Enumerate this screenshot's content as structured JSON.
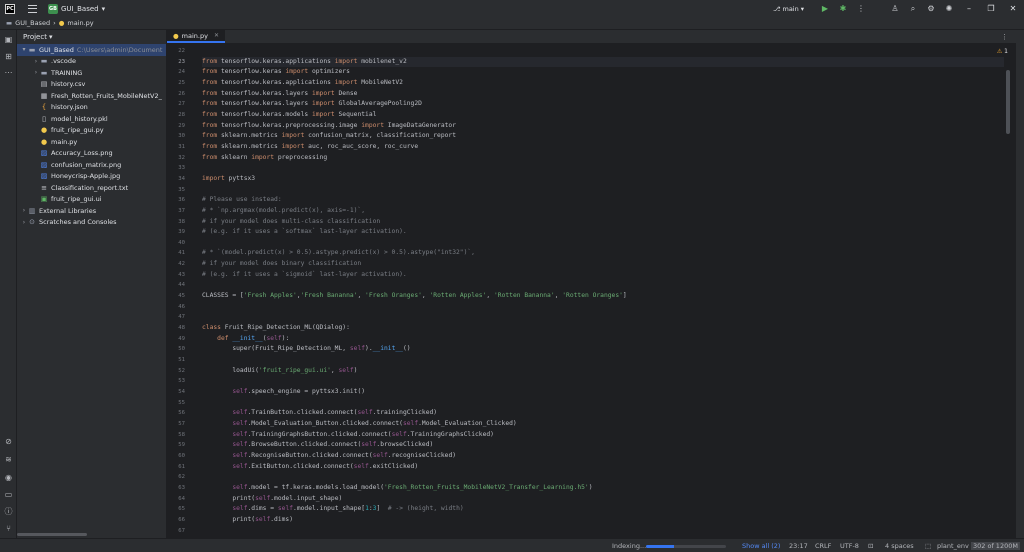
{
  "titlebar": {
    "logo": "PC",
    "project_badge": "GB",
    "project_name": "GUI_Based",
    "branch": "main"
  },
  "breadcrumb": [
    "GUI_Based",
    "main.py"
  ],
  "project_panel": {
    "title": "Project",
    "root_name": "GUI_Based",
    "root_path": "C:\\Users\\admin\\Document",
    "items": [
      {
        "label": ".vscode",
        "type": "folder",
        "icon": "folder-icon"
      },
      {
        "label": "TRAINING",
        "type": "folder",
        "icon": "folder-icon"
      },
      {
        "label": "history.csv",
        "type": "file",
        "icon": "csv-file-icon"
      },
      {
        "label": "Fresh_Rotten_Fruits_MobileNetV2_",
        "type": "file",
        "icon": "h5-file-icon"
      },
      {
        "label": "history.json",
        "type": "file",
        "icon": "json-file-icon"
      },
      {
        "label": "model_history.pkl",
        "type": "file",
        "icon": "file-icon"
      },
      {
        "label": "fruit_ripe_gui.py",
        "type": "file",
        "icon": "python-file-icon"
      },
      {
        "label": "main.py",
        "type": "file",
        "icon": "python-file-icon"
      },
      {
        "label": "Accuracy_Loss.png",
        "type": "file",
        "icon": "image-file-icon"
      },
      {
        "label": "confusion_matrix.png",
        "type": "file",
        "icon": "image-file-icon"
      },
      {
        "label": "Honeycrisp-Apple.jpg",
        "type": "file",
        "icon": "image-file-icon"
      },
      {
        "label": "Classification_report.txt",
        "type": "file",
        "icon": "text-file-icon"
      },
      {
        "label": "fruit_ripe_gui.ui",
        "type": "file",
        "icon": "ui-file-icon"
      }
    ],
    "external_libraries": "External Libraries",
    "scratches": "Scratches and Consoles"
  },
  "editor": {
    "tab_label": "main.py",
    "warning_count": "1",
    "first_line_number": 22,
    "active_line": 23,
    "lines": [
      "",
      "from tensorflow.keras.applications import mobilenet_v2",
      "from tensorflow.keras import optimizers",
      "from tensorflow.keras.applications import MobileNetV2",
      "from tensorflow.keras.layers import Dense",
      "from tensorflow.keras.layers import GlobalAveragePooling2D",
      "from tensorflow.keras.models import Sequential",
      "from tensorflow.keras.preprocessing.image import ImageDataGenerator",
      "from sklearn.metrics import confusion_matrix, classification_report",
      "from sklearn.metrics import auc, roc_auc_score, roc_curve",
      "from sklearn import preprocessing",
      "",
      "import pyttsx3",
      "",
      "# Please use instead:",
      "# * `np.argmax(model.predict(x), axis=-1)`,",
      "# if your model does multi-class classification",
      "# (e.g. if it uses a `softmax` last-layer activation).",
      "",
      "# * `(model.predict(x) > 0.5).astype.predict(x) > 0.5).astype(\"int32\")`,",
      "# if your model does binary classification",
      "# (e.g. if it uses a `sigmoid` last-layer activation).",
      "",
      "CLASSES = ['Fresh Apples','Fresh Bananna', 'Fresh Oranges', 'Rotten Apples', 'Rotten Bananna', 'Rotten Oranges']",
      "",
      "",
      "class Fruit_Ripe_Detection_ML(QDialog):",
      "    def __init__(self):",
      "        super(Fruit_Ripe_Detection_ML, self).__init__()",
      "",
      "        loadUi('fruit_ripe_gui.ui', self)",
      "",
      "        self.speech_engine = pyttsx3.init()",
      "",
      "        self.TrainButton.clicked.connect(self.trainingClicked)",
      "        self.Model_Evaluation_Button.clicked.connect(self.Model_Evaluation_Clicked)",
      "        self.TrainingGraphsButton.clicked.connect(self.TrainingGraphsClicked)",
      "        self.BrowseButton.clicked.connect(self.browseClicked)",
      "        self.RecogniseButton.clicked.connect(self.recogniseClicked)",
      "        self.ExitButton.clicked.connect(self.exitClicked)",
      "",
      "        self.model = tf.keras.models.load_model('Fresh_Rotten_Fruits_MobileNetV2_Transfer_Learning.h5')",
      "        print(self.model.input_shape)",
      "        self.dims = self.model.input_shape[1:3]  # -> (height, width)",
      "        print(self.dims)",
      ""
    ]
  },
  "statusbar": {
    "indexing": "Indexing...",
    "indexing_progress": 0.35,
    "show_all": "Show all (2)",
    "position": "23:17",
    "line_ending": "CRLF",
    "encoding": "UTF-8",
    "indent": "4 spaces",
    "interpreter": "plant_env",
    "memory": "302 of 1200M"
  },
  "colors": {
    "accent": "#3574f0",
    "keyword": "#cf8e6d",
    "string": "#6aab73",
    "comment": "#7a7e85",
    "background": "#1e1f22"
  }
}
